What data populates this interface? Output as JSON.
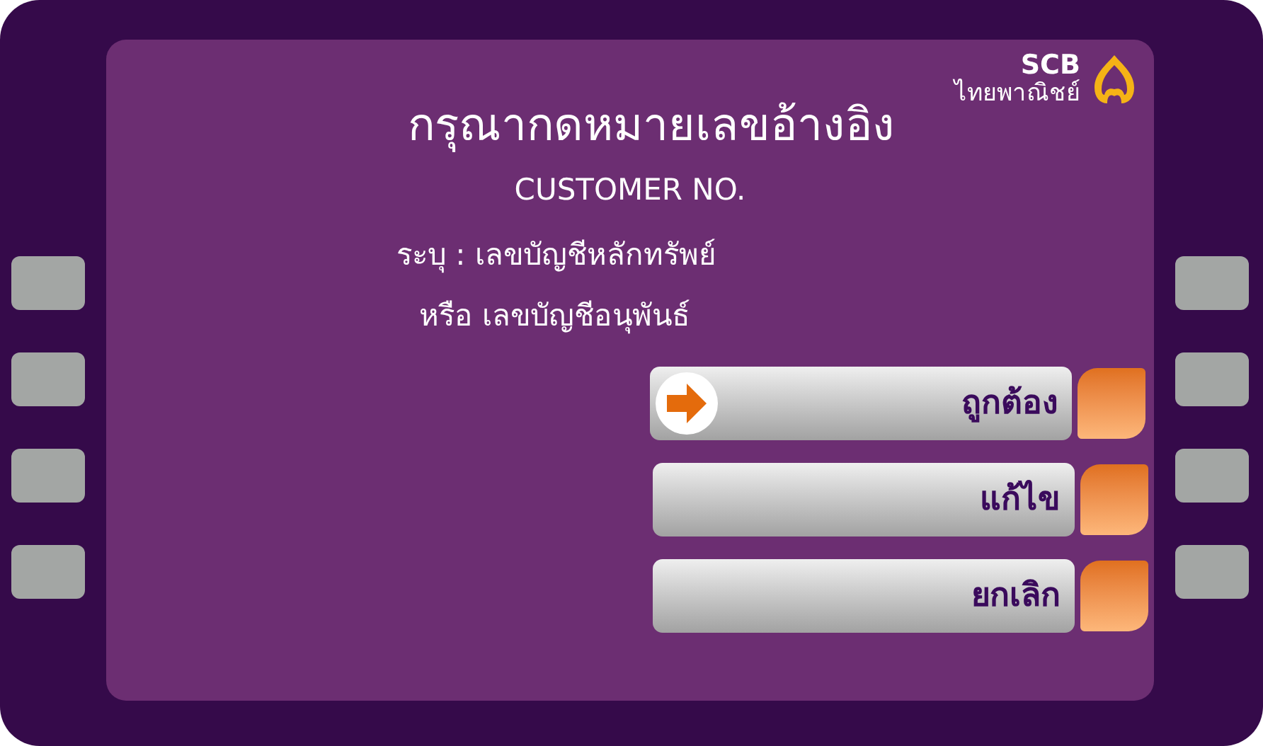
{
  "logo": {
    "name": "SCB",
    "subtitle": "ไทยพาณิชย์"
  },
  "title": "กรุณากดหมายเลขอ้างอิง",
  "subtitle": "CUSTOMER NO.",
  "instructions": [
    "ระบุ : เลขบัญชีหลักทรัพย์",
    "หรือ เลขบัญชีอนุพันธ์"
  ],
  "options": [
    {
      "label": "ถูกต้อง",
      "selected": true
    },
    {
      "label": "แก้ไข",
      "selected": false
    },
    {
      "label": "ยกเลิก",
      "selected": false
    }
  ]
}
